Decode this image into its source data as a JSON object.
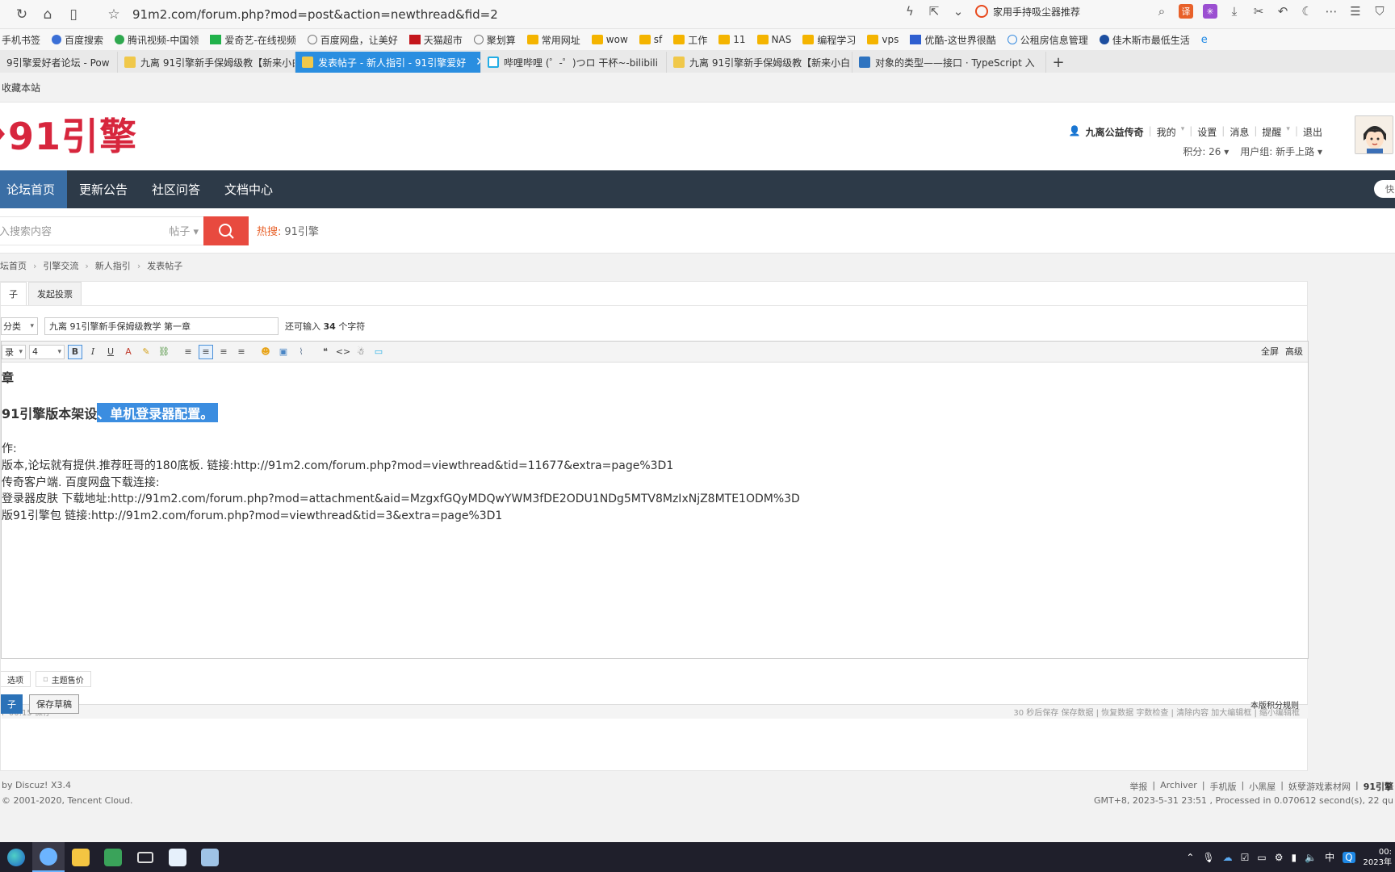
{
  "browser": {
    "url": "91m2.com/forum.php?mod=post&action=newthread&fid=2",
    "suggestion": "家用手持吸尘器推荐",
    "bookmarks": [
      "手机书签",
      "百度搜索",
      "腾讯视频-中国领",
      "爱奇艺-在线视频",
      "百度网盘，让美好",
      "天猫超市",
      "聚划算",
      "常用网址",
      "wow",
      "sf",
      "工作",
      "11",
      "NAS",
      "编程学习",
      "vps",
      "优酷-这世界很酷",
      "公租房信息管理",
      "佳木斯市最低生活"
    ],
    "tabs": [
      {
        "label": "9引擎爱好者论坛 - Pow",
        "active": false
      },
      {
        "label": "九离 91引擎新手保姆级教【新来小白",
        "active": false
      },
      {
        "label": "发表帖子 - 新人指引 - 91引擎爱好",
        "active": true
      },
      {
        "label": "哔哩哔哩 (゜-゜)つロ 干杯~-bilibili",
        "active": false
      },
      {
        "label": "九离 91引擎新手保姆级教【新来小白",
        "active": false
      },
      {
        "label": "对象的类型——接口 · TypeScript 入",
        "active": false
      }
    ],
    "new_tab": "+"
  },
  "site": {
    "favorite": "收藏本站",
    "logo": "91引擎",
    "user": {
      "name": "九离公益传奇",
      "links": [
        "我的",
        "设置",
        "消息",
        "提醒",
        "退出"
      ],
      "points": "积分: 26",
      "group": "用户组: 新手上路"
    },
    "nav": [
      "论坛首页",
      "更新公告",
      "社区问答",
      "文档中心"
    ],
    "nav_pill": "快",
    "search": {
      "placeholder": "入搜索内容",
      "type": "帖子",
      "hot_label": "热搜:",
      "hot_value": "91引擎"
    },
    "breadcrumbs": [
      "坛首页",
      "引擎交流",
      "新人指引",
      "发表帖子"
    ]
  },
  "post": {
    "tabs": [
      "子",
      "发起投票"
    ],
    "category": "分类",
    "title": "九离 91引擎新手保姆级教学 第一章",
    "char_hint": "还可输入",
    "char_count": "34",
    "char_unit": "个字符",
    "toolbar": {
      "font": "录",
      "size": "4",
      "fullscreen": "全屏",
      "advanced": "高级"
    },
    "content": {
      "chapter": "章",
      "heading_plain": "91引擎版本架设",
      "heading_selected": "、单机登录器配置。",
      "lines": [
        "作:",
        "版本,论坛就有提供.推荐旺哥的180底板.  链接:http://91m2.com/forum.php?mod=viewthread&tid=11677&extra=page%3D1",
        "传奇客户端.   百度网盘下载连接:",
        "登录器皮肤   下载地址:http://91m2.com/forum.php?mod=attachment&aid=MzgxfGQyMDQwYWM3fDE2ODU1NDg5MTV8MzIxNjZ8MTE1ODM%3D",
        "版91引擎包   链接:http://91m2.com/forum.php?mod=viewthread&tid=3&extra=page%3D1"
      ]
    },
    "footer_left": "F 00:15 保存",
    "footer_right": "30 秒后保存 保存数据 | 恢复数据    字数检查 | 清除内容    加大编辑框 | 缩小编辑框",
    "options": [
      "选项",
      "主题售价"
    ],
    "submit": "子",
    "save_draft": "保存草稿",
    "rules": "本版积分规则"
  },
  "footer": {
    "powered": "by Discuz! X3.4",
    "copyright": "© 2001-2020, Tencent Cloud.",
    "links": [
      "举报",
      "Archiver",
      "手机版",
      "小黑屋",
      "妖孽游戏素材网",
      "91引擎"
    ],
    "stats": "GMT+8, 2023-5-31 23:51 , Processed in 0.070612 second(s), 22 qu"
  },
  "taskbar": {
    "time": "00:",
    "date": "2023年",
    "ime": "中"
  },
  "colors": {
    "nav_bg": "#2d3a48",
    "accent_red": "#d7263d",
    "active_tab": "#2a8ee0",
    "selection": "#3b8de0"
  }
}
